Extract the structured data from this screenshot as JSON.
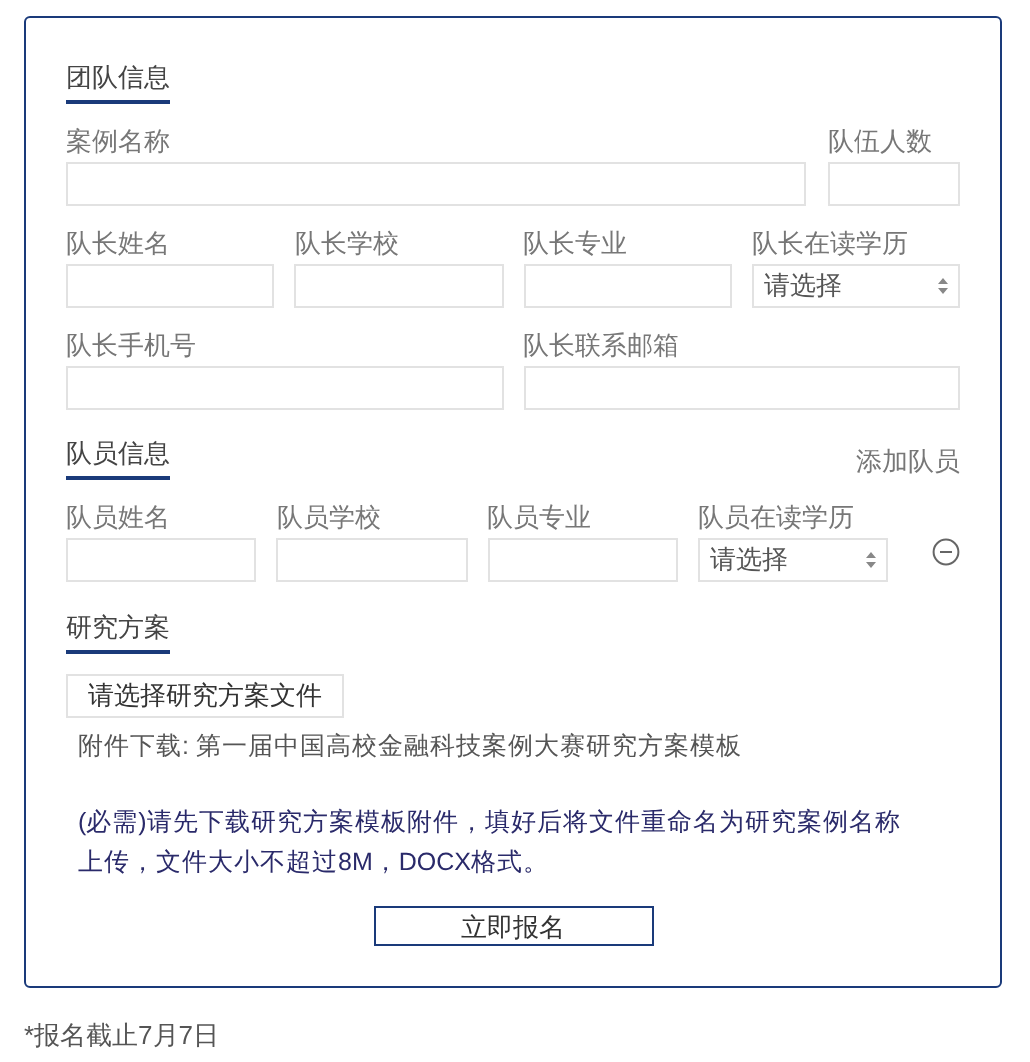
{
  "team_section": {
    "title": "团队信息",
    "case_name": {
      "label": "案例名称",
      "kind": "text"
    },
    "team_size": {
      "label": "队伍人数",
      "kind": "text"
    },
    "leader_fields": [
      {
        "label": "队长姓名",
        "kind": "text"
      },
      {
        "label": "队长学校",
        "kind": "text"
      },
      {
        "label": "队长专业",
        "kind": "text"
      },
      {
        "label": "队长在读学历",
        "kind": "select",
        "value": "请选择"
      }
    ],
    "contact_fields": [
      {
        "label": "队长手机号",
        "kind": "text"
      },
      {
        "label": "队长联系邮箱",
        "kind": "text"
      }
    ]
  },
  "member_section": {
    "title": "队员信息",
    "add_link": "添加队员",
    "fields": [
      {
        "label": "队员姓名",
        "kind": "text"
      },
      {
        "label": "队员学校",
        "kind": "text"
      },
      {
        "label": "队员专业",
        "kind": "text"
      },
      {
        "label": "队员在读学历",
        "kind": "select",
        "value": "请选择"
      }
    ]
  },
  "plan_section": {
    "title": "研究方案",
    "file_button": "请选择研究方案文件",
    "download": "附件下载: 第一届中国高校金融科技案例大赛研究方案模板",
    "note": "(必需)请先下载研究方案模板附件，填好后将文件重命名为研究案例名称上传，文件大小不超过8M，DOCX格式。"
  },
  "submit": "立即报名",
  "footer": "*报名截止7月7日"
}
